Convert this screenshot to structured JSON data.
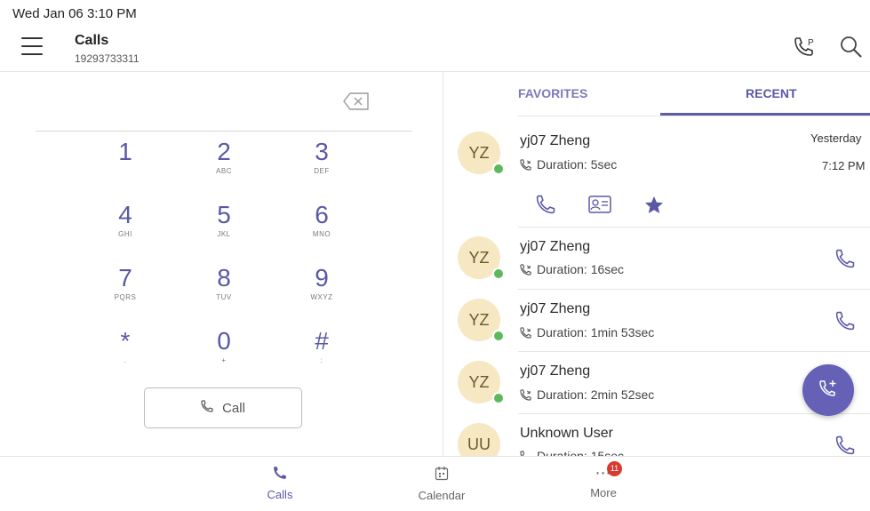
{
  "status_bar": {
    "datetime": "Wed Jan 06  3:10 PM"
  },
  "header": {
    "title": "Calls",
    "number": "19293733311"
  },
  "dialpad": {
    "keys": [
      {
        "digit": "1",
        "letters": ""
      },
      {
        "digit": "2",
        "letters": "ABC"
      },
      {
        "digit": "3",
        "letters": "DEF"
      },
      {
        "digit": "4",
        "letters": "GHI"
      },
      {
        "digit": "5",
        "letters": "JKL"
      },
      {
        "digit": "6",
        "letters": "MNO"
      },
      {
        "digit": "7",
        "letters": "PQRS"
      },
      {
        "digit": "8",
        "letters": "TUV"
      },
      {
        "digit": "9",
        "letters": "WXYZ"
      },
      {
        "digit": "*",
        "letters": "."
      },
      {
        "digit": "0",
        "letters": "+"
      },
      {
        "digit": "#",
        "letters": ":"
      }
    ],
    "call_label": "Call"
  },
  "tabs": [
    {
      "label": "FAVORITES",
      "active": false
    },
    {
      "label": "RECENT",
      "active": true
    }
  ],
  "recent": [
    {
      "initials": "YZ",
      "name": "yj07 Zheng",
      "duration": "Duration: 5sec",
      "date": "Yesterday",
      "time": "7:12 PM",
      "online": true
    },
    {
      "initials": "YZ",
      "name": "yj07 Zheng",
      "duration": "Duration: 16sec",
      "online": true
    },
    {
      "initials": "YZ",
      "name": "yj07 Zheng",
      "duration": "Duration: 1min 53sec",
      "online": true
    },
    {
      "initials": "YZ",
      "name": "yj07 Zheng",
      "duration": "Duration: 2min 52sec",
      "online": true
    },
    {
      "initials": "UU",
      "name": "Unknown User",
      "duration": "Duration: 15sec",
      "online": false
    }
  ],
  "nav": {
    "calls": "Calls",
    "calendar": "Calendar",
    "more": "More",
    "more_badge": "11"
  },
  "colors": {
    "accent": "#5a58a6",
    "fab": "#6461b6",
    "avatar_bg": "#f6e8c3",
    "presence": "#5cb85c",
    "badge": "#d93a2f"
  },
  "icons": [
    "menu-icon",
    "call-park-icon",
    "search-icon",
    "backspace-icon",
    "phone-icon",
    "contact-card-icon",
    "star-icon",
    "new-call-icon",
    "calendar-icon",
    "more-icon"
  ]
}
